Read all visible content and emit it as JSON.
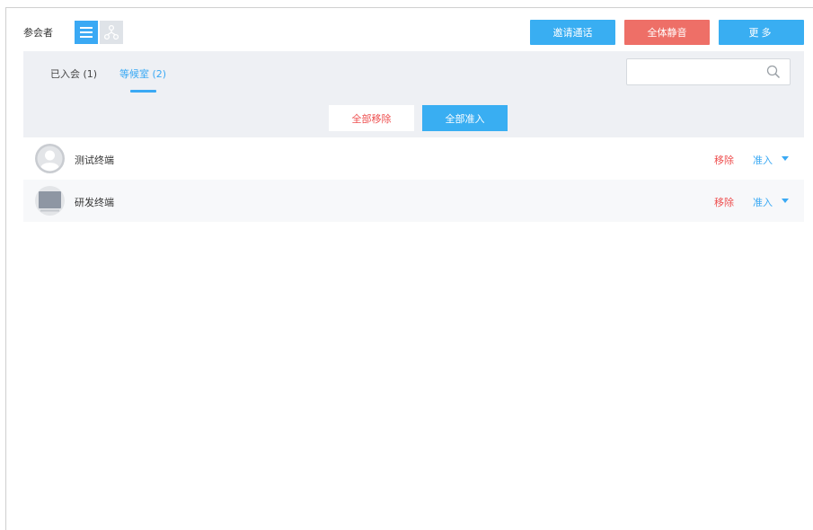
{
  "header": {
    "title": "参会者",
    "view_list_icon": "list-icon",
    "view_tree_icon": "topology-icon",
    "invite_label": "邀请通话",
    "mute_all_label": "全体静音",
    "more_label": "更多"
  },
  "tabs": [
    {
      "label": "已入会 (1)",
      "active": false
    },
    {
      "label": "等候室 (2)",
      "active": true
    }
  ],
  "search": {
    "placeholder": "",
    "icon": "search-icon"
  },
  "bulk_actions": {
    "remove_all_label": "全部移除",
    "admit_all_label": "全部准入"
  },
  "participants": [
    {
      "name": "测试终端",
      "avatar": "user-avatar-icon",
      "remove_label": "移除",
      "admit_label": "准入"
    },
    {
      "name": "研发终端",
      "avatar": "device-avatar-icon",
      "remove_label": "移除",
      "admit_label": "准入"
    }
  ],
  "colors": {
    "primary": "#39aef2",
    "danger": "#ee6f67",
    "bar_bg": "#eef0f4"
  }
}
